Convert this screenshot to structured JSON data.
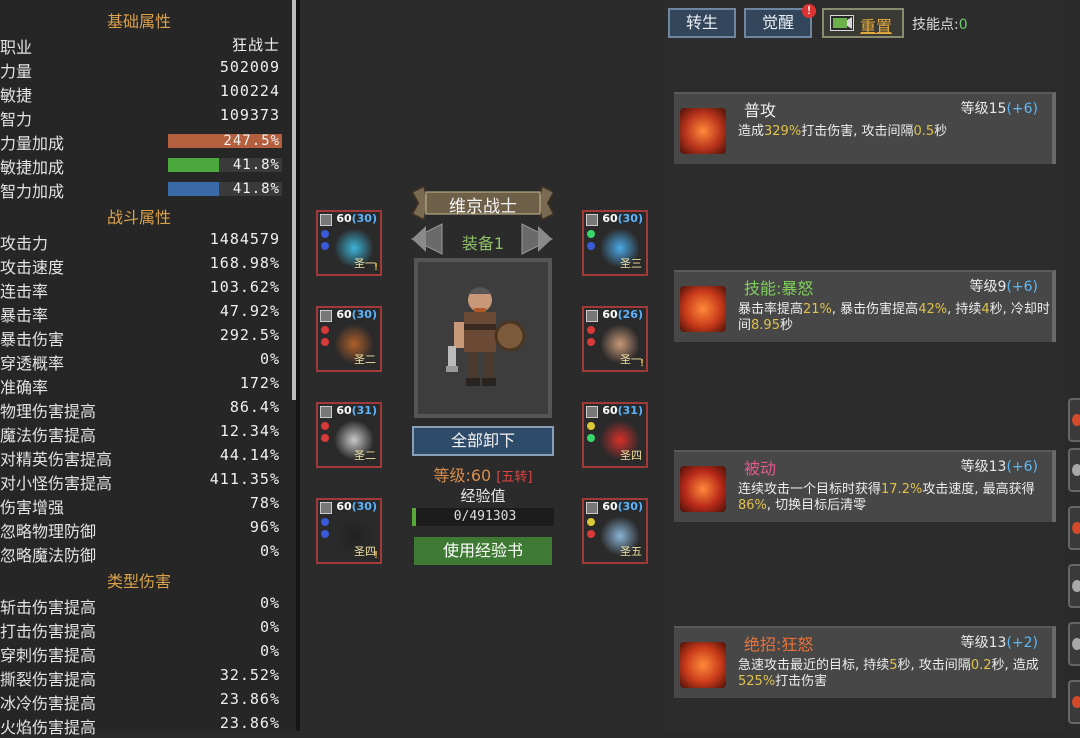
{
  "left": {
    "basic_title": "基础属性",
    "basic": [
      {
        "label": "职业",
        "value": "狂战士"
      },
      {
        "label": "力量",
        "value": "502009"
      },
      {
        "label": "敏捷",
        "value": "100224"
      },
      {
        "label": "智力",
        "value": "109373"
      }
    ],
    "bonuses": [
      {
        "label": "力量加成",
        "value": "247.5%",
        "fraction": 1.0,
        "color": "#b45f3e"
      },
      {
        "label": "敏捷加成",
        "value": "41.8%",
        "fraction": 0.45,
        "color": "#4aa83c"
      },
      {
        "label": "智力加成",
        "value": "41.8%",
        "fraction": 0.45,
        "color": "#3a6aa8"
      }
    ],
    "battle_title": "战斗属性",
    "battle": [
      {
        "label": "攻击力",
        "value": "1484579"
      },
      {
        "label": "攻击速度",
        "value": "168.98%"
      },
      {
        "label": "连击率",
        "value": "103.62%"
      },
      {
        "label": "暴击率",
        "value": "47.92%"
      },
      {
        "label": "暴击伤害",
        "value": "292.5%"
      },
      {
        "label": "穿透概率",
        "value": "0%"
      },
      {
        "label": "准确率",
        "value": "172%"
      },
      {
        "label": "物理伤害提高",
        "value": "86.4%"
      },
      {
        "label": "魔法伤害提高",
        "value": "12.34%"
      },
      {
        "label": "对精英伤害提高",
        "value": "44.14%"
      },
      {
        "label": "对小怪伤害提高",
        "value": "411.35%"
      },
      {
        "label": "伤害增强",
        "value": "78%"
      },
      {
        "label": "忽略物理防御",
        "value": "96%"
      },
      {
        "label": "忽略魔法防御",
        "value": "0%"
      }
    ],
    "type_title": "类型伤害",
    "type": [
      {
        "label": "斩击伤害提高",
        "value": "0%"
      },
      {
        "label": "打击伤害提高",
        "value": "0%"
      },
      {
        "label": "穿刺伤害提高",
        "value": "0%"
      },
      {
        "label": "撕裂伤害提高",
        "value": "32.52%"
      },
      {
        "label": "冰冷伤害提高",
        "value": "23.86%"
      },
      {
        "label": "火焰伤害提高",
        "value": "23.86%"
      }
    ]
  },
  "center": {
    "class_banner": "维京战士",
    "equip_set": "装备1",
    "unequip_all": "全部卸下",
    "level_label": "等级:60",
    "rebirth_tag": "[五转]",
    "exp_label": "经验值",
    "exp_value": "0/491303",
    "exp_fraction": 0,
    "use_book": "使用经验书",
    "slots": [
      {
        "level": "60",
        "bonus": "(30)",
        "tag": "圣一",
        "warn": true,
        "icon": "tiara-icon"
      },
      {
        "level": "60",
        "bonus": "(30)",
        "tag": "圣二",
        "warn": false,
        "icon": "lute-icon"
      },
      {
        "level": "60",
        "bonus": "(31)",
        "tag": "圣二",
        "warn": false,
        "icon": "skull-glove-icon"
      },
      {
        "level": "60",
        "bonus": "(30)",
        "tag": "圣四",
        "warn": true,
        "icon": "boots-icon"
      },
      {
        "level": "60",
        "bonus": "(30)",
        "tag": "圣三",
        "warn": false,
        "icon": "amulet-icon"
      },
      {
        "level": "60",
        "bonus": "(26)",
        "tag": "圣一",
        "warn": true,
        "icon": "pet-icon"
      },
      {
        "level": "60",
        "bonus": "(31)",
        "tag": "圣四",
        "warn": false,
        "icon": "eye-ring-icon"
      },
      {
        "level": "60",
        "bonus": "(30)",
        "tag": "圣五",
        "warn": false,
        "icon": "axe-weapon-icon"
      }
    ]
  },
  "right": {
    "rebirth": "转生",
    "awaken": "觉醒",
    "awaken_badge": "!",
    "reset": "重置",
    "skill_points_label": "技能点:",
    "skill_points": "0",
    "skills": [
      {
        "name": "普攻",
        "name_color": "#f0f0f0",
        "level": "等级15",
        "bonus": "(+6)",
        "desc": [
          [
            "造成",
            ""
          ],
          [
            "329%",
            "y"
          ],
          [
            "打击伤害, 攻击间隔",
            ""
          ],
          [
            "0.5",
            "y"
          ],
          [
            "秒",
            ""
          ]
        ]
      },
      {
        "name": "技能:暴怒",
        "name_color": "#7fcf5a",
        "level": "等级9",
        "bonus": "(+6)",
        "desc": [
          [
            "暴击率提高",
            ""
          ],
          [
            "21%",
            "y"
          ],
          [
            ", 暴击伤害提高",
            ""
          ],
          [
            "42%",
            "y"
          ],
          [
            ", 持续",
            ""
          ],
          [
            "4",
            "y"
          ],
          [
            "秒, 冷却时间",
            ""
          ],
          [
            "8.95",
            "y"
          ],
          [
            "秒",
            ""
          ]
        ]
      },
      {
        "name": "被动",
        "name_color": "#e05a8c",
        "level": "等级13",
        "bonus": "(+6)",
        "desc": [
          [
            "连续攻击一个目标时获得",
            ""
          ],
          [
            "17.2%",
            "y"
          ],
          [
            "攻击速度, 最高获得",
            ""
          ],
          [
            "86%",
            "y"
          ],
          [
            ", 切换目标后清零",
            ""
          ]
        ]
      },
      {
        "name": "绝招:狂怒",
        "name_color": "#e8733a",
        "level": "等级13",
        "bonus": "(+2)",
        "desc": [
          [
            "急速攻击最近的目标, 持续",
            ""
          ],
          [
            "5",
            "y"
          ],
          [
            "秒, 攻击间隔",
            ""
          ],
          [
            "0.2",
            "y"
          ],
          [
            "秒, 造成",
            ""
          ],
          [
            "525%",
            "y"
          ],
          [
            "打击伤害",
            ""
          ]
        ]
      }
    ]
  }
}
